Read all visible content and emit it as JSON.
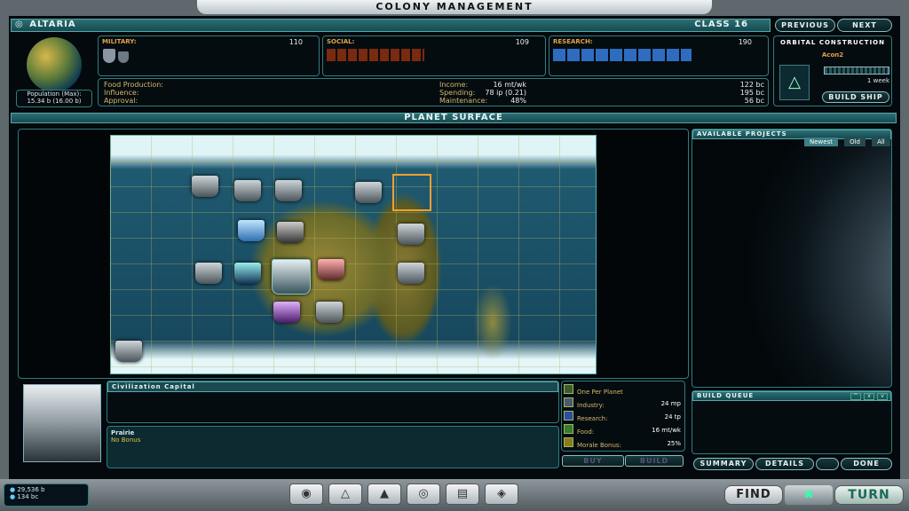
{
  "window_title": "Colony Management",
  "planet": {
    "name": "Altaria",
    "class": "Class 16",
    "pop_label": "Population (Max):",
    "pop_value": "15.34 b (16.00 b)"
  },
  "nav": {
    "previous": "Previous",
    "next": "Next"
  },
  "military": {
    "label": "Military:",
    "value": "110"
  },
  "social": {
    "label": "Social:",
    "value": "109"
  },
  "research": {
    "label": "Research:",
    "value": "190"
  },
  "economy": {
    "food_label": "Food Production:",
    "food": "16 mt/wk",
    "influence_label": "Influence:",
    "influence": "78 ip (0.21)",
    "approval_label": "Approval:",
    "approval": "48%",
    "income_label": "Income:",
    "income": "122 bc",
    "spending_label": "Spending:",
    "spending": "195 bc",
    "maintenance_label": "Maintenance:",
    "maintenance": "56 bc"
  },
  "orbital": {
    "title": "Orbital Construction",
    "ship": "Acon2",
    "time": "1 week",
    "build_ship": "Build Ship"
  },
  "surface_title": "Planet Surface",
  "projects": {
    "title": "Available Projects",
    "tabs": [
      "Newest",
      "Old",
      "All"
    ]
  },
  "build_queue": {
    "title": "Build Queue"
  },
  "tile": {
    "name": "Civilization Capital",
    "terrain": "Prairie",
    "bonus": "No Bonus"
  },
  "stats": [
    {
      "label": "One Per Planet",
      "value": ""
    },
    {
      "label": "Industry:",
      "value": "24 mp"
    },
    {
      "label": "Research:",
      "value": "24 tp"
    },
    {
      "label": "Food:",
      "value": "16 mt/wk"
    },
    {
      "label": "Morale Bonus:",
      "value": "25%"
    }
  ],
  "actions": {
    "buy": "Buy",
    "build": "Build",
    "summary": "Summary",
    "details": "Details",
    "done": "Done"
  },
  "footer": {
    "pop": "29,536 b",
    "credits": "134 bc",
    "find": "FIND",
    "turn": "TURN"
  },
  "colors": {
    "accent": "#2f7c80",
    "label": "#e0a24a",
    "bar": "#1d5a60"
  }
}
